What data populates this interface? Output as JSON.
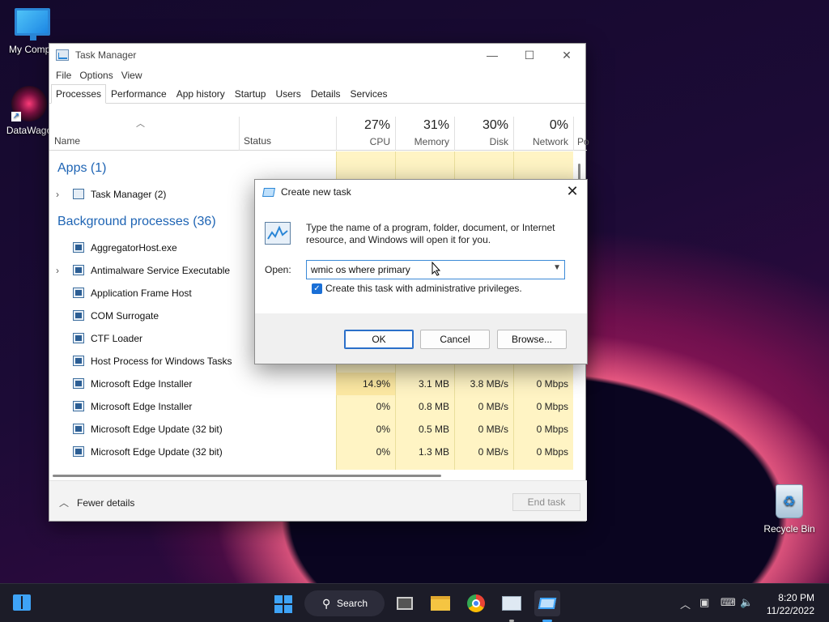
{
  "desktop": {
    "icons": [
      {
        "label": "My Compu"
      },
      {
        "label": "DataWago"
      },
      {
        "label": "Recycle Bin"
      }
    ]
  },
  "task_manager": {
    "title": "Task Manager",
    "menu": [
      "File",
      "Options",
      "View"
    ],
    "tabs": [
      "Processes",
      "Performance",
      "App history",
      "Startup",
      "Users",
      "Details",
      "Services"
    ],
    "active_tab": "Processes",
    "columns": {
      "name": "Name",
      "status": "Status",
      "cpu": {
        "pct": "27%",
        "label": "CPU"
      },
      "memory": {
        "pct": "31%",
        "label": "Memory"
      },
      "disk": {
        "pct": "30%",
        "label": "Disk"
      },
      "network": {
        "pct": "0%",
        "label": "Network"
      },
      "power": "Po"
    },
    "sections": {
      "apps": "Apps (1)",
      "background": "Background processes (36)"
    },
    "apps": [
      {
        "name": "Task Manager (2)",
        "expandable": true
      }
    ],
    "background": [
      {
        "name": "AggregatorHost.exe",
        "expandable": false,
        "cpu": "",
        "memory": "",
        "disk": "",
        "network": ""
      },
      {
        "name": "Antimalware Service Executable",
        "expandable": true,
        "cpu": "",
        "memory": "",
        "disk": "",
        "network": ""
      },
      {
        "name": "Application Frame Host",
        "expandable": false,
        "cpu": "",
        "memory": "",
        "disk": "",
        "network": ""
      },
      {
        "name": "COM Surrogate",
        "expandable": false,
        "cpu": "",
        "memory": "",
        "disk": "",
        "network": ""
      },
      {
        "name": "CTF Loader",
        "expandable": false,
        "cpu": "",
        "memory": "",
        "disk": "",
        "network": ""
      },
      {
        "name": "Host Process for Windows Tasks",
        "expandable": false,
        "cpu": "",
        "memory": "",
        "disk": "",
        "network": ""
      },
      {
        "name": "Microsoft Edge Installer",
        "expandable": false,
        "cpu": "14.9%",
        "memory": "3.1 MB",
        "disk": "3.8 MB/s",
        "network": "0 Mbps"
      },
      {
        "name": "Microsoft Edge Installer",
        "expandable": false,
        "cpu": "0%",
        "memory": "0.8 MB",
        "disk": "0 MB/s",
        "network": "0 Mbps"
      },
      {
        "name": "Microsoft Edge Update (32 bit)",
        "expandable": false,
        "cpu": "0%",
        "memory": "0.5 MB",
        "disk": "0 MB/s",
        "network": "0 Mbps"
      },
      {
        "name": "Microsoft Edge Update (32 bit)",
        "expandable": false,
        "cpu": "0%",
        "memory": "1.3 MB",
        "disk": "0 MB/s",
        "network": "0 Mbps"
      }
    ],
    "footer": {
      "fewer_details": "Fewer details",
      "end_task": "End task"
    }
  },
  "run_dialog": {
    "title": "Create new task",
    "description": "Type the name of a program, folder, document, or Internet resource, and Windows will open it for you.",
    "open_label": "Open:",
    "open_value": "wmic os where primary",
    "admin_checkbox_label": "Create this task with administrative privileges.",
    "admin_checked": true,
    "buttons": {
      "ok": "OK",
      "cancel": "Cancel",
      "browse": "Browse..."
    }
  },
  "taskbar": {
    "search_label": "Search",
    "clock_time": "8:20 PM",
    "clock_date": "11/22/2022"
  },
  "colors": {
    "accent": "#1a6fd6",
    "section_blue": "#1e64b4",
    "heat_light": "#fff4c4",
    "heat_hot": "#fde9a3",
    "taskbar": "#1c1c28"
  }
}
